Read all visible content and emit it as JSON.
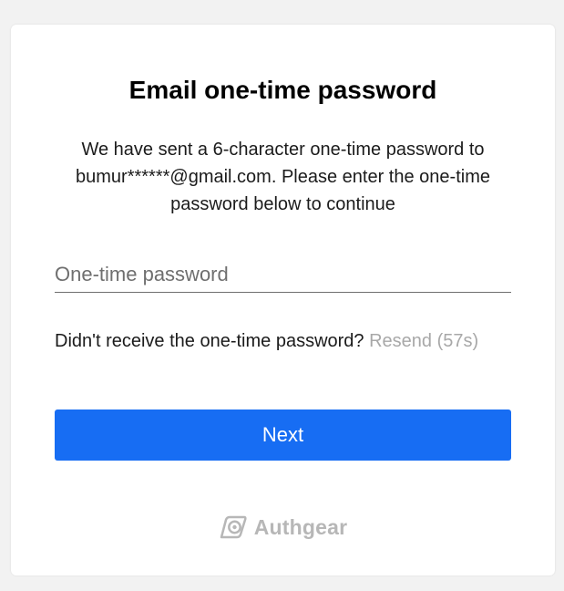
{
  "page": {
    "title": "Email one-time password",
    "description": "We have sent a 6-character one-time password to bumur******@gmail.com. Please enter the one-time password below to continue"
  },
  "otp_field": {
    "value": "",
    "placeholder": "One-time password"
  },
  "resend": {
    "prompt": "Didn't receive the one-time password?",
    "link_label": "Resend (57s)"
  },
  "next_button": {
    "label": "Next"
  },
  "branding": {
    "logo_icon": "authgear-logo-icon",
    "name": "Authgear"
  },
  "colors": {
    "background": "#f2f2f2",
    "card": "#ffffff",
    "primary": "#176df3",
    "link_disabled": "#a8a8a8",
    "brand_gray": "#b7b7b7"
  }
}
